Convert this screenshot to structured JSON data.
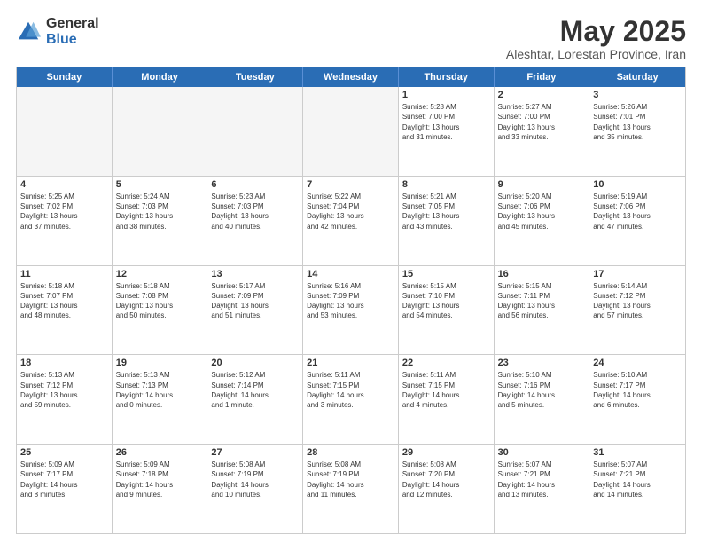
{
  "logo": {
    "general": "General",
    "blue": "Blue"
  },
  "header": {
    "month_year": "May 2025",
    "location": "Aleshtar, Lorestan Province, Iran"
  },
  "weekdays": [
    "Sunday",
    "Monday",
    "Tuesday",
    "Wednesday",
    "Thursday",
    "Friday",
    "Saturday"
  ],
  "rows": [
    [
      {
        "day": "",
        "info": "",
        "empty": true
      },
      {
        "day": "",
        "info": "",
        "empty": true
      },
      {
        "day": "",
        "info": "",
        "empty": true
      },
      {
        "day": "",
        "info": "",
        "empty": true
      },
      {
        "day": "1",
        "info": "Sunrise: 5:28 AM\nSunset: 7:00 PM\nDaylight: 13 hours\nand 31 minutes.",
        "empty": false
      },
      {
        "day": "2",
        "info": "Sunrise: 5:27 AM\nSunset: 7:00 PM\nDaylight: 13 hours\nand 33 minutes.",
        "empty": false
      },
      {
        "day": "3",
        "info": "Sunrise: 5:26 AM\nSunset: 7:01 PM\nDaylight: 13 hours\nand 35 minutes.",
        "empty": false
      }
    ],
    [
      {
        "day": "4",
        "info": "Sunrise: 5:25 AM\nSunset: 7:02 PM\nDaylight: 13 hours\nand 37 minutes.",
        "empty": false
      },
      {
        "day": "5",
        "info": "Sunrise: 5:24 AM\nSunset: 7:03 PM\nDaylight: 13 hours\nand 38 minutes.",
        "empty": false
      },
      {
        "day": "6",
        "info": "Sunrise: 5:23 AM\nSunset: 7:03 PM\nDaylight: 13 hours\nand 40 minutes.",
        "empty": false
      },
      {
        "day": "7",
        "info": "Sunrise: 5:22 AM\nSunset: 7:04 PM\nDaylight: 13 hours\nand 42 minutes.",
        "empty": false
      },
      {
        "day": "8",
        "info": "Sunrise: 5:21 AM\nSunset: 7:05 PM\nDaylight: 13 hours\nand 43 minutes.",
        "empty": false
      },
      {
        "day": "9",
        "info": "Sunrise: 5:20 AM\nSunset: 7:06 PM\nDaylight: 13 hours\nand 45 minutes.",
        "empty": false
      },
      {
        "day": "10",
        "info": "Sunrise: 5:19 AM\nSunset: 7:06 PM\nDaylight: 13 hours\nand 47 minutes.",
        "empty": false
      }
    ],
    [
      {
        "day": "11",
        "info": "Sunrise: 5:18 AM\nSunset: 7:07 PM\nDaylight: 13 hours\nand 48 minutes.",
        "empty": false
      },
      {
        "day": "12",
        "info": "Sunrise: 5:18 AM\nSunset: 7:08 PM\nDaylight: 13 hours\nand 50 minutes.",
        "empty": false
      },
      {
        "day": "13",
        "info": "Sunrise: 5:17 AM\nSunset: 7:09 PM\nDaylight: 13 hours\nand 51 minutes.",
        "empty": false
      },
      {
        "day": "14",
        "info": "Sunrise: 5:16 AM\nSunset: 7:09 PM\nDaylight: 13 hours\nand 53 minutes.",
        "empty": false
      },
      {
        "day": "15",
        "info": "Sunrise: 5:15 AM\nSunset: 7:10 PM\nDaylight: 13 hours\nand 54 minutes.",
        "empty": false
      },
      {
        "day": "16",
        "info": "Sunrise: 5:15 AM\nSunset: 7:11 PM\nDaylight: 13 hours\nand 56 minutes.",
        "empty": false
      },
      {
        "day": "17",
        "info": "Sunrise: 5:14 AM\nSunset: 7:12 PM\nDaylight: 13 hours\nand 57 minutes.",
        "empty": false
      }
    ],
    [
      {
        "day": "18",
        "info": "Sunrise: 5:13 AM\nSunset: 7:12 PM\nDaylight: 13 hours\nand 59 minutes.",
        "empty": false
      },
      {
        "day": "19",
        "info": "Sunrise: 5:13 AM\nSunset: 7:13 PM\nDaylight: 14 hours\nand 0 minutes.",
        "empty": false
      },
      {
        "day": "20",
        "info": "Sunrise: 5:12 AM\nSunset: 7:14 PM\nDaylight: 14 hours\nand 1 minute.",
        "empty": false
      },
      {
        "day": "21",
        "info": "Sunrise: 5:11 AM\nSunset: 7:15 PM\nDaylight: 14 hours\nand 3 minutes.",
        "empty": false
      },
      {
        "day": "22",
        "info": "Sunrise: 5:11 AM\nSunset: 7:15 PM\nDaylight: 14 hours\nand 4 minutes.",
        "empty": false
      },
      {
        "day": "23",
        "info": "Sunrise: 5:10 AM\nSunset: 7:16 PM\nDaylight: 14 hours\nand 5 minutes.",
        "empty": false
      },
      {
        "day": "24",
        "info": "Sunrise: 5:10 AM\nSunset: 7:17 PM\nDaylight: 14 hours\nand 6 minutes.",
        "empty": false
      }
    ],
    [
      {
        "day": "25",
        "info": "Sunrise: 5:09 AM\nSunset: 7:17 PM\nDaylight: 14 hours\nand 8 minutes.",
        "empty": false
      },
      {
        "day": "26",
        "info": "Sunrise: 5:09 AM\nSunset: 7:18 PM\nDaylight: 14 hours\nand 9 minutes.",
        "empty": false
      },
      {
        "day": "27",
        "info": "Sunrise: 5:08 AM\nSunset: 7:19 PM\nDaylight: 14 hours\nand 10 minutes.",
        "empty": false
      },
      {
        "day": "28",
        "info": "Sunrise: 5:08 AM\nSunset: 7:19 PM\nDaylight: 14 hours\nand 11 minutes.",
        "empty": false
      },
      {
        "day": "29",
        "info": "Sunrise: 5:08 AM\nSunset: 7:20 PM\nDaylight: 14 hours\nand 12 minutes.",
        "empty": false
      },
      {
        "day": "30",
        "info": "Sunrise: 5:07 AM\nSunset: 7:21 PM\nDaylight: 14 hours\nand 13 minutes.",
        "empty": false
      },
      {
        "day": "31",
        "info": "Sunrise: 5:07 AM\nSunset: 7:21 PM\nDaylight: 14 hours\nand 14 minutes.",
        "empty": false
      }
    ]
  ]
}
